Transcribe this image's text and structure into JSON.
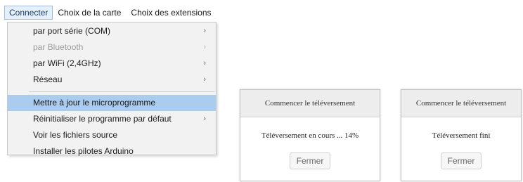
{
  "menubar": {
    "items": [
      {
        "label": "Connecter"
      },
      {
        "label": "Choix de la carte"
      },
      {
        "label": "Choix des extensions"
      }
    ]
  },
  "dropdown": {
    "items": [
      {
        "label": "par port série (COM)",
        "chevron": "›"
      },
      {
        "label": "par Bluetooth",
        "chevron": "›"
      },
      {
        "label": "par WiFi (2,4GHz)",
        "chevron": "›"
      },
      {
        "label": "Réseau",
        "chevron": "›"
      },
      {
        "label": "Mettre à jour le microprogramme"
      },
      {
        "label": "Réinitialiser le programme par défaut",
        "chevron": "›"
      },
      {
        "label": "Voir les fichiers source"
      },
      {
        "label": "Installer les pilotes Arduino"
      }
    ]
  },
  "dialogs": [
    {
      "title": "Commencer le téléversement",
      "message": "Téléversement en cours ... 14%",
      "progress_percent": 14,
      "button": "Fermer"
    },
    {
      "title": "Commencer le téléversement",
      "message": "Téléversement fini",
      "button": "Fermer"
    }
  ],
  "colors": {
    "highlight": "#a9ccef",
    "disabled_text": "#9b9b9b",
    "menu_bg": "#f2f2f2"
  }
}
